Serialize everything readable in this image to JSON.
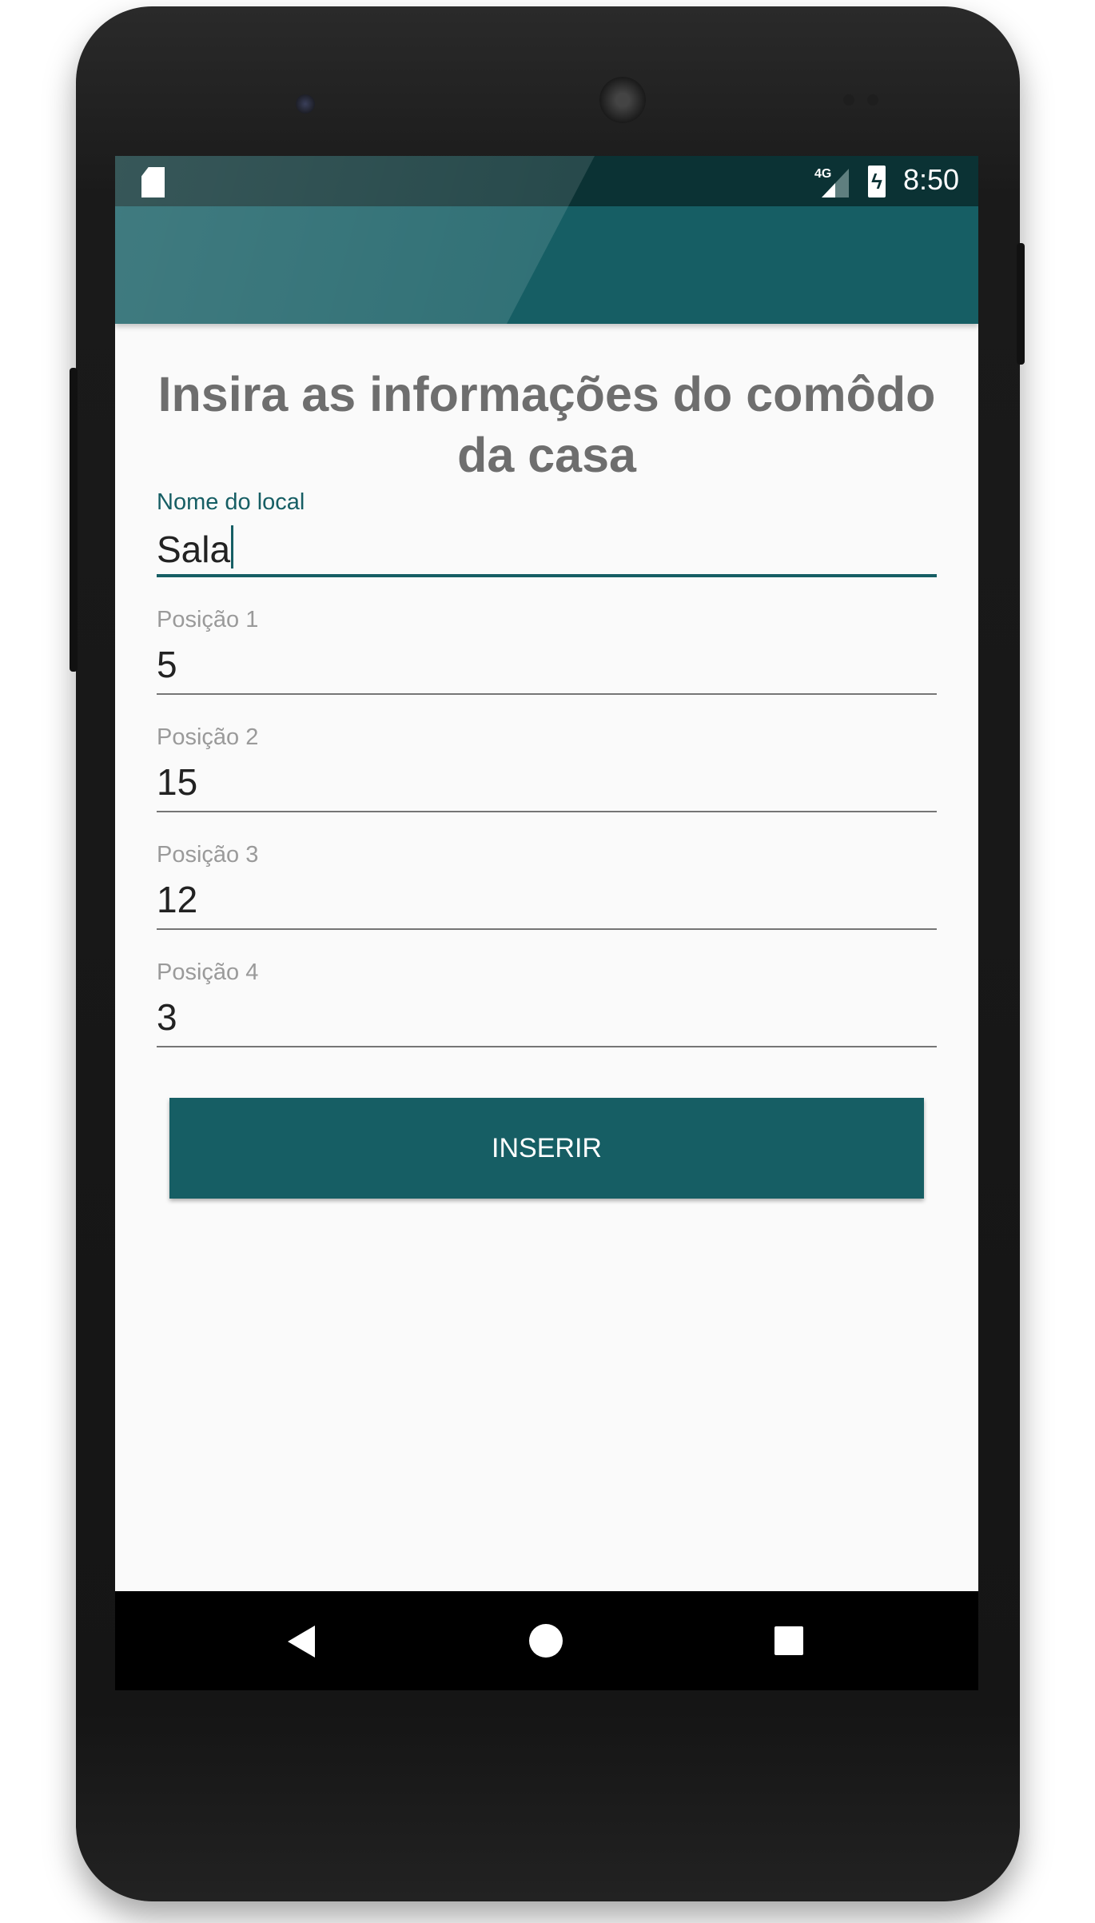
{
  "status_bar": {
    "network": "4G",
    "time": "8:50"
  },
  "form": {
    "title": "Insira as informações do comôdo da casa",
    "fields": [
      {
        "label": "Nome do local",
        "value": "Sala"
      },
      {
        "label": "Posição 1",
        "value": "5"
      },
      {
        "label": "Posição 2",
        "value": "15"
      },
      {
        "label": "Posição 3",
        "value": "12"
      },
      {
        "label": "Posição 4",
        "value": "3"
      }
    ],
    "submit_label": "INSERIR"
  },
  "colors": {
    "primary": "#165e64",
    "primary_dark": "#0b3234",
    "background": "#fafafa"
  }
}
